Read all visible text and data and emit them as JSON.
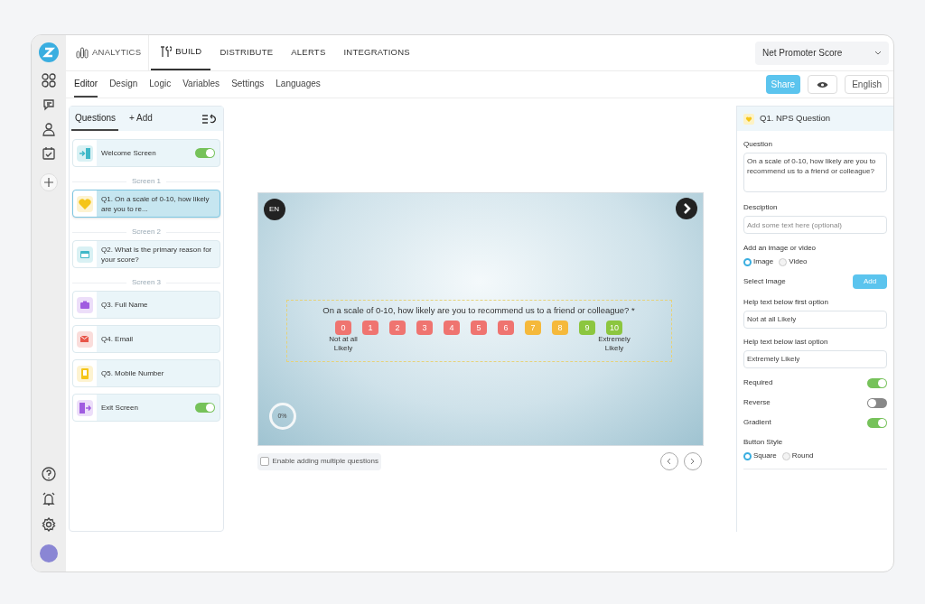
{
  "top_nav": [
    {
      "label": "ANALYTICS",
      "selected": false
    },
    {
      "label": "BUILD",
      "selected": true
    },
    {
      "label": "DISTRIBUTE",
      "selected": false
    },
    {
      "label": "ALERTS",
      "selected": false
    },
    {
      "label": "INTEGRATIONS",
      "selected": false
    }
  ],
  "survey_select": {
    "value": "Net Promoter Score"
  },
  "sub_tabs": [
    {
      "label": "Editor",
      "selected": true
    },
    {
      "label": "Design",
      "selected": false
    },
    {
      "label": "Logic",
      "selected": false
    },
    {
      "label": "Variables",
      "selected": false
    },
    {
      "label": "Settings",
      "selected": false
    },
    {
      "label": "Languages",
      "selected": false
    }
  ],
  "actions": {
    "share": "Share",
    "language": "English"
  },
  "questions_panel": {
    "tabs": [
      {
        "label": "Questions",
        "selected": true
      },
      {
        "label": "+ Add",
        "selected": false
      }
    ],
    "items": [
      {
        "kind": "welcome",
        "label": "Welcome Screen",
        "color": "#3fb8c8",
        "toggle": true,
        "selected": false
      },
      {
        "kind": "divider",
        "label": "Screen 1"
      },
      {
        "kind": "nps",
        "label": "Q1. On a scale of 0-10, how likely are you to re...",
        "color": "#f5c518",
        "selected": true
      },
      {
        "kind": "divider",
        "label": "Screen 2"
      },
      {
        "kind": "open_text",
        "label": "Q2. What is the primary reason for your score?",
        "color": "#3fb8c8",
        "selected": false
      },
      {
        "kind": "divider",
        "label": "Screen 3"
      },
      {
        "kind": "name",
        "label": "Q3. Full Name",
        "color": "#a05ce0",
        "selected": false
      },
      {
        "kind": "email",
        "label": "Q4. Email",
        "color": "#e8564a",
        "selected": false
      },
      {
        "kind": "phone",
        "label": "Q5. Mobile Number",
        "color": "#f5c518",
        "selected": false
      },
      {
        "kind": "exit",
        "label": "Exit Screen",
        "color": "#a05ce0",
        "toggle": true,
        "selected": false
      }
    ]
  },
  "preview": {
    "language": "EN",
    "question": "On a scale of 0-10, how likely are you to recommend us to a friend or colleague? *",
    "scale": [
      {
        "label": "0",
        "color": "#ef7470",
        "help": "Not at all Likely"
      },
      {
        "label": "1",
        "color": "#ef7470"
      },
      {
        "label": "2",
        "color": "#ef7470"
      },
      {
        "label": "3",
        "color": "#ef7470"
      },
      {
        "label": "4",
        "color": "#ef7470"
      },
      {
        "label": "5",
        "color": "#ef7470"
      },
      {
        "label": "6",
        "color": "#ef7470"
      },
      {
        "label": "7",
        "color": "#f5b93b"
      },
      {
        "label": "8",
        "color": "#f5b93b"
      },
      {
        "label": "9",
        "color": "#8cc63f"
      },
      {
        "label": "10",
        "color": "#8cc63f",
        "help": "Extremely Likely"
      }
    ],
    "progress": "0%",
    "multiple_questions": {
      "label": "Enable adding multiple questions",
      "checked": false
    }
  },
  "properties": {
    "title": "Q1. NPS Question",
    "question_label": "Question",
    "question_value": "On a scale of 0-10, how likely are you to recommend us to a friend or colleague?",
    "description_label": "Desciption",
    "description_placeholder": "Add some text here (optional)",
    "media_label": "Add an image or video",
    "media_options": [
      {
        "label": "Image",
        "selected": true
      },
      {
        "label": "Video",
        "selected": false
      }
    ],
    "select_image_label": "Select Image",
    "add_button": "Add",
    "first_help_label": "Help text below first option",
    "first_help_value": "Not at all Likely",
    "last_help_label": "Help text below last option",
    "last_help_value": "Extremely Likely",
    "toggles": [
      {
        "label": "Required",
        "on": true
      },
      {
        "label": "Reverse",
        "on": false
      },
      {
        "label": "Gradient",
        "on": true
      }
    ],
    "button_style_label": "Button Style",
    "button_styles": [
      {
        "label": "Square",
        "selected": true
      },
      {
        "label": "Round",
        "selected": false
      }
    ]
  }
}
